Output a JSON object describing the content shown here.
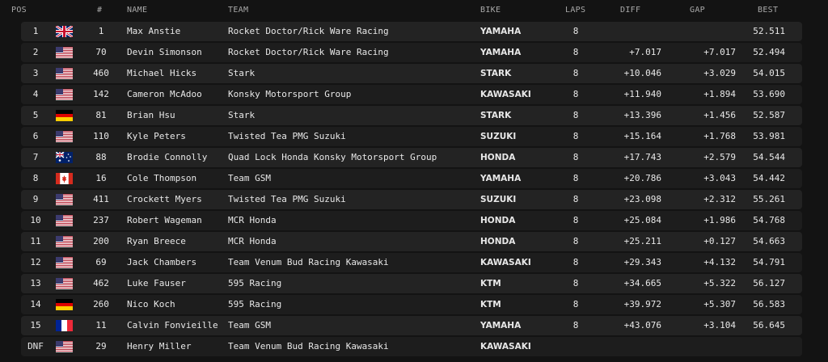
{
  "headers": {
    "pos": "POS",
    "num": "#",
    "name": "NAME",
    "team": "TEAM",
    "bike": "BIKE",
    "laps": "LAPS",
    "diff": "DIFF",
    "gap": "GAP",
    "best": "BEST"
  },
  "rows": [
    {
      "pos": "1",
      "flag": "uk-flag-icon",
      "num": "1",
      "name": "Max Anstie",
      "team": "Rocket Doctor/Rick Ware Racing",
      "bike": "YAMAHA",
      "laps": "8",
      "diff": "",
      "gap": "",
      "best": "52.511"
    },
    {
      "pos": "2",
      "flag": "usa-flag-icon",
      "num": "70",
      "name": "Devin Simonson",
      "team": "Rocket Doctor/Rick Ware Racing",
      "bike": "YAMAHA",
      "laps": "8",
      "diff": "+7.017",
      "gap": "+7.017",
      "best": "52.494"
    },
    {
      "pos": "3",
      "flag": "usa-flag-icon",
      "num": "460",
      "name": "Michael Hicks",
      "team": "Stark",
      "bike": "STARK",
      "laps": "8",
      "diff": "+10.046",
      "gap": "+3.029",
      "best": "54.015"
    },
    {
      "pos": "4",
      "flag": "usa-flag-icon",
      "num": "142",
      "name": "Cameron McAdoo",
      "team": "Konsky Motorsport Group",
      "bike": "KAWASAKI",
      "laps": "8",
      "diff": "+11.940",
      "gap": "+1.894",
      "best": "53.690"
    },
    {
      "pos": "5",
      "flag": "germany-flag-icon",
      "num": "81",
      "name": "Brian Hsu",
      "team": "Stark",
      "bike": "STARK",
      "laps": "8",
      "diff": "+13.396",
      "gap": "+1.456",
      "best": "52.587"
    },
    {
      "pos": "6",
      "flag": "usa-flag-icon",
      "num": "110",
      "name": "Kyle Peters",
      "team": "Twisted Tea PMG Suzuki",
      "bike": "SUZUKI",
      "laps": "8",
      "diff": "+15.164",
      "gap": "+1.768",
      "best": "53.981"
    },
    {
      "pos": "7",
      "flag": "australia-flag-icon",
      "num": "88",
      "name": "Brodie Connolly",
      "team": "Quad Lock Honda Konsky Motorsport Group",
      "bike": "HONDA",
      "laps": "8",
      "diff": "+17.743",
      "gap": "+2.579",
      "best": "54.544"
    },
    {
      "pos": "8",
      "flag": "canada-flag-icon",
      "num": "16",
      "name": "Cole Thompson",
      "team": "Team GSM",
      "bike": "YAMAHA",
      "laps": "8",
      "diff": "+20.786",
      "gap": "+3.043",
      "best": "54.442"
    },
    {
      "pos": "9",
      "flag": "usa-flag-icon",
      "num": "411",
      "name": "Crockett Myers",
      "team": "Twisted Tea PMG Suzuki",
      "bike": "SUZUKI",
      "laps": "8",
      "diff": "+23.098",
      "gap": "+2.312",
      "best": "55.261"
    },
    {
      "pos": "10",
      "flag": "usa-flag-icon",
      "num": "237",
      "name": "Robert Wageman",
      "team": "MCR Honda",
      "bike": "HONDA",
      "laps": "8",
      "diff": "+25.084",
      "gap": "+1.986",
      "best": "54.768"
    },
    {
      "pos": "11",
      "flag": "usa-flag-icon",
      "num": "200",
      "name": "Ryan Breece",
      "team": "MCR Honda",
      "bike": "HONDA",
      "laps": "8",
      "diff": "+25.211",
      "gap": "+0.127",
      "best": "54.663"
    },
    {
      "pos": "12",
      "flag": "usa-flag-icon",
      "num": "69",
      "name": "Jack Chambers",
      "team": "Team Venum Bud Racing Kawasaki",
      "bike": "KAWASAKI",
      "laps": "8",
      "diff": "+29.343",
      "gap": "+4.132",
      "best": "54.791"
    },
    {
      "pos": "13",
      "flag": "usa-flag-icon",
      "num": "462",
      "name": "Luke Fauser",
      "team": "595 Racing",
      "bike": "KTM",
      "laps": "8",
      "diff": "+34.665",
      "gap": "+5.322",
      "best": "56.127"
    },
    {
      "pos": "14",
      "flag": "germany-flag-icon",
      "num": "260",
      "name": "Nico Koch",
      "team": "595 Racing",
      "bike": "KTM",
      "laps": "8",
      "diff": "+39.972",
      "gap": "+5.307",
      "best": "56.583"
    },
    {
      "pos": "15",
      "flag": "france-flag-icon",
      "num": "11",
      "name": "Calvin Fonvieille",
      "team": "Team GSM",
      "bike": "YAMAHA",
      "laps": "8",
      "diff": "+43.076",
      "gap": "+3.104",
      "best": "56.645"
    },
    {
      "pos": "DNF",
      "flag": "usa-flag-icon",
      "num": "29",
      "name": "Henry Miller",
      "team": "Team Venum Bud Racing Kawasaki",
      "bike": "KAWASAKI",
      "laps": "",
      "diff": "",
      "gap": "",
      "best": ""
    }
  ]
}
